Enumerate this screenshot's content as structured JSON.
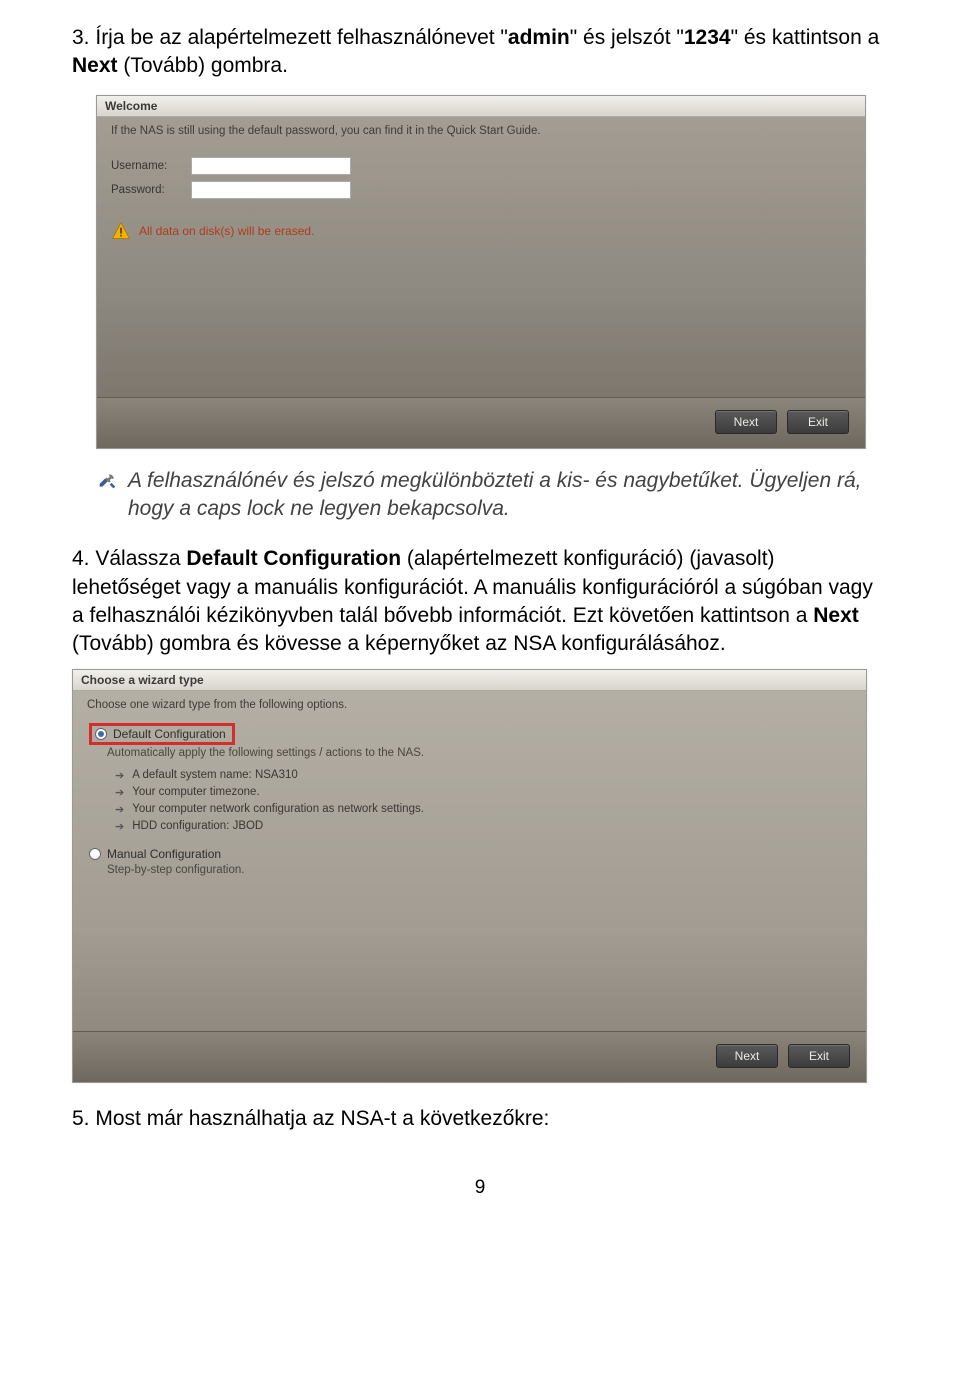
{
  "step3": {
    "number": "3.",
    "text_before_admin": "Írja be az alapértelmezett felhasználónevet \"",
    "admin": "admin",
    "between_admin_pw": "\" és jelszót \"",
    "pw": "1234",
    "after_pw": "\" és kattintson a ",
    "next_bold": "Next",
    "after_next": " (Tovább) gombra."
  },
  "screenshot1": {
    "title": "Welcome",
    "subtext": "If the NAS is still using the default password, you can find it in the Quick Start Guide.",
    "username_label": "Username:",
    "password_label": "Password:",
    "warning": "All data on disk(s) will be erased.",
    "btn_next": "Next",
    "btn_exit": "Exit"
  },
  "note": {
    "line1": "A felhasználónév és jelszó megkülönbözteti a kis- és nagybetűket. Ügyeljen rá, hogy a caps lock ne legyen bekapcsolva."
  },
  "step4": {
    "number": "4.",
    "t1": "Válassza ",
    "bold1": "Default Configuration",
    "t2": " (alapértelmezett konfiguráció) (javasolt) lehetőséget vagy a manuális konfigurációt. A manuális konfigurációról a súgóban vagy a felhasználói kézikönyvben talál bővebb információt. Ezt követően kattintson a ",
    "bold2": "Next",
    "t3": " (Tovább) gombra és kövesse a képernyőket az NSA konfigurálásához."
  },
  "screenshot2": {
    "heading": "Choose a wizard type",
    "sub": "Choose one wizard type from the following options.",
    "opt1_label": "Default Configuration",
    "opt1_sub": "Automatically apply the following settings / actions to the NAS.",
    "list": [
      "A default system name: NSA310",
      "Your computer timezone.",
      "Your computer network configuration as network settings.",
      "HDD configuration: JBOD"
    ],
    "opt2_label": "Manual Configuration",
    "opt2_sub": "Step-by-step configuration.",
    "btn_next": "Next",
    "btn_exit": "Exit"
  },
  "step5": {
    "number": "5.",
    "text": "Most már használhatja az NSA-t a következőkre:"
  },
  "page_number": "9"
}
